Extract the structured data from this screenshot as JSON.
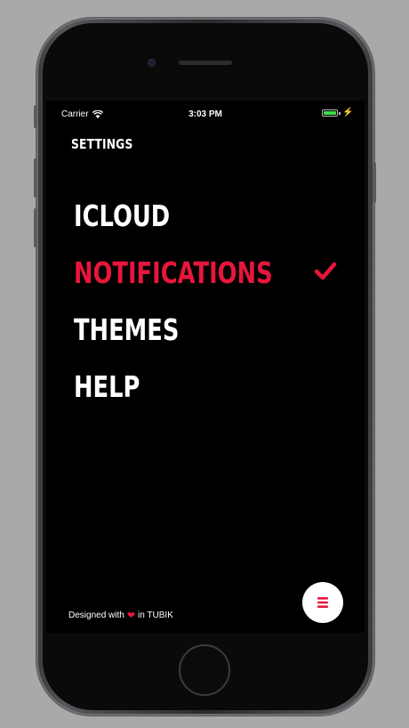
{
  "status_bar": {
    "carrier": "Carrier",
    "time": "3:03 PM"
  },
  "screen_title": "SETTINGS",
  "menu": {
    "items": [
      {
        "label": "ICLOUD",
        "selected": false
      },
      {
        "label": "NOTIFICATIONS",
        "selected": true
      },
      {
        "label": "THEMES",
        "selected": false
      },
      {
        "label": "HELP",
        "selected": false
      }
    ]
  },
  "footer": {
    "prefix": "Designed with",
    "suffix": "in TUBIK",
    "heart_icon": "heart-icon"
  },
  "fab": {
    "icon": "menu-icon"
  },
  "colors": {
    "accent": "#e8163c",
    "background": "#000000",
    "text": "#ffffff"
  }
}
